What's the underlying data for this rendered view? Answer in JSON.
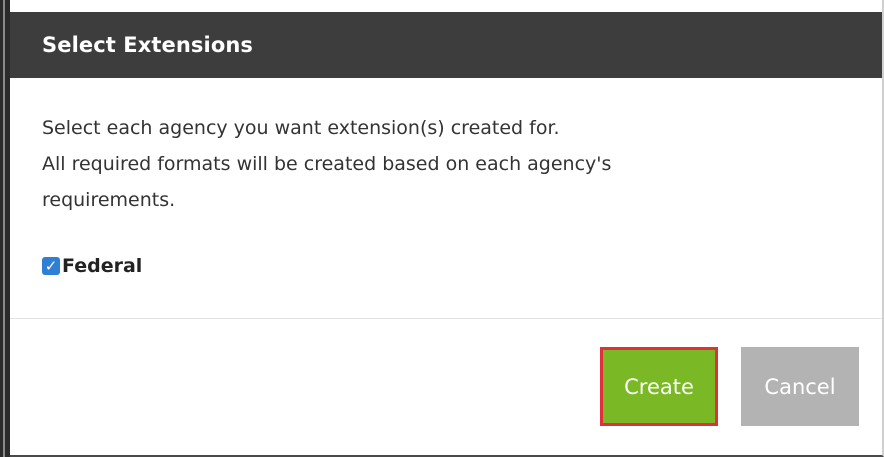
{
  "dialog": {
    "title": "Select Extensions",
    "description_lines": [
      "Select each agency you want extension(s) created for.",
      "All required formats will be created based on each agency's",
      "requirements."
    ],
    "agencies": [
      {
        "label": "Federal",
        "checked": true
      }
    ],
    "buttons": {
      "create_label": "Create",
      "cancel_label": "Cancel"
    }
  },
  "colors": {
    "titlebar": "#3d3d3d",
    "create_button": "#7ab826",
    "create_highlight": "#e0303a",
    "cancel_button": "#b3b3b3",
    "checkbox": "#2f7fd4"
  },
  "icons": {
    "checkbox": "check-mark-icon"
  }
}
